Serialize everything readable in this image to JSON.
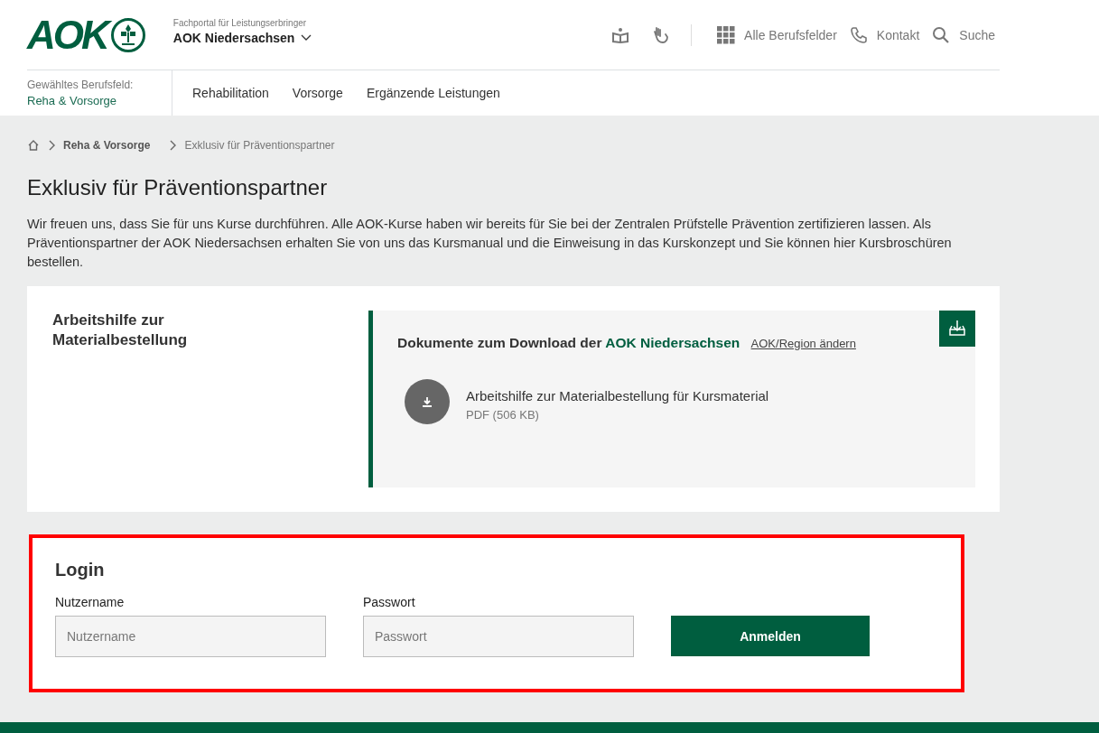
{
  "header": {
    "logo": "AOK",
    "portal_label": "Fachportal für Leistungserbringer",
    "region": "AOK Niedersachsen",
    "tools": [
      {
        "kind": "grid",
        "label": "Alle Berufsfelder"
      },
      {
        "kind": "phone",
        "label": "Kontakt"
      },
      {
        "kind": "search",
        "label": "Suche"
      }
    ]
  },
  "field": {
    "label": "Gewähltes Berufsfeld:",
    "value": "Reha & Vorsorge"
  },
  "nav": [
    "Rehabilitation",
    "Vorsorge",
    "Ergänzende Leistungen"
  ],
  "breadcrumb": [
    "Reha & Vorsorge",
    "Exklusiv für Präventionspartner"
  ],
  "title": "Exklusiv für Präventionspartner",
  "intro": "Wir freuen uns, dass Sie für uns Kurse durchführen. Alle AOK-Kurse haben wir bereits für Sie bei der Zentralen Prüfstelle Prävention zertifizieren lassen. Als Präventionspartner der AOK Niedersachsen erhalten Sie von uns das Kursmanual und die Einweisung in das Kurskonzept und Sie können hier Kursbroschüren bestellen.",
  "download_card": {
    "title": "Arbeitshilfe zur Materialbestellung",
    "heading": "Dokumente zum Download der",
    "region": "AOK Niedersachsen",
    "change_link": "AOK/Region ändern",
    "files": [
      {
        "name": "Arbeitshilfe zur Materialbestellung für Kursmaterial",
        "meta": "PDF (506 KB)"
      }
    ]
  },
  "login": {
    "title": "Login",
    "highlighted": true,
    "fields": [
      {
        "label": "Nutzername",
        "placeholder": "Nutzername"
      },
      {
        "label": "Passwort",
        "placeholder": "Passwort"
      }
    ],
    "button": "Anmelden"
  }
}
